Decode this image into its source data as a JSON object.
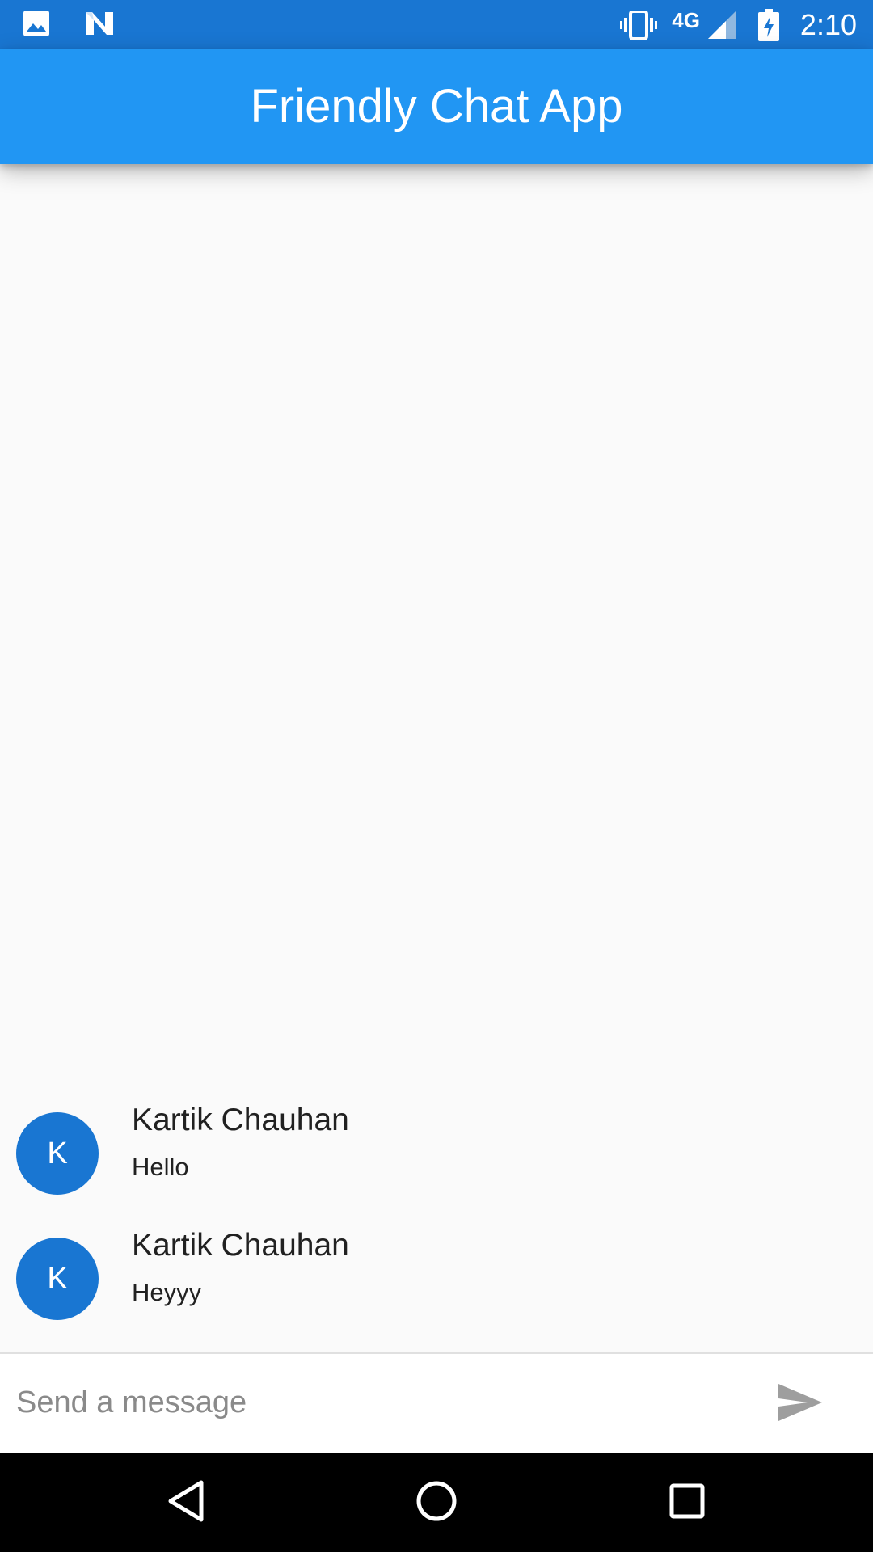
{
  "status_bar": {
    "network_type": "4G",
    "time": "2:10",
    "icons": [
      "gallery-icon",
      "n-logo-icon",
      "vibrate-icon",
      "signal-icon",
      "battery-charging-icon"
    ]
  },
  "app_bar": {
    "title": "Friendly Chat App"
  },
  "messages": [
    {
      "avatar_initial": "K",
      "sender": "Kartik Chauhan",
      "text": "Hello"
    },
    {
      "avatar_initial": "K",
      "sender": "Kartik Chauhan",
      "text": "Heyyy"
    }
  ],
  "composer": {
    "placeholder": "Send a message",
    "value": "",
    "send_icon": "send-icon"
  },
  "nav_bar": {
    "icons": [
      "back-icon",
      "home-icon",
      "recents-icon"
    ]
  },
  "colors": {
    "status_bar": "#1976d2",
    "app_bar": "#2196f3",
    "avatar": "#1976d2",
    "background": "#fafafa"
  }
}
